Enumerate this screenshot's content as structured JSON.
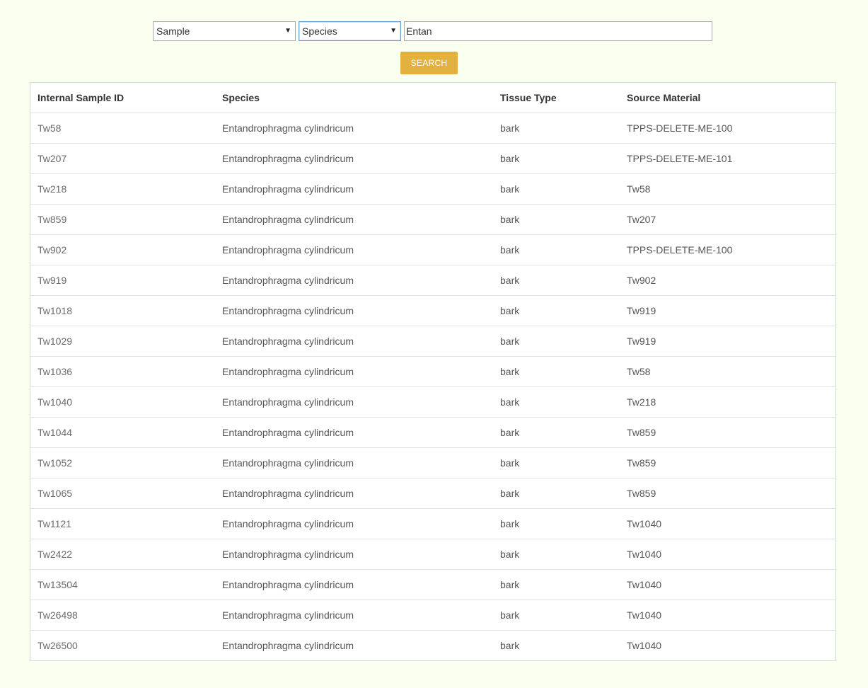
{
  "search": {
    "field_select": "Sample",
    "field_select_arrow": "▼",
    "filter_select": "Species",
    "filter_select_arrow": "▼",
    "query_value": "Entan",
    "button_label": "SEARCH"
  },
  "table": {
    "headers": [
      "Internal Sample ID",
      "Species",
      "Tissue Type",
      "Source Material"
    ],
    "rows": [
      [
        "Tw58",
        "Entandrophragma cylindricum",
        "bark",
        "TPPS-DELETE-ME-100"
      ],
      [
        "Tw207",
        "Entandrophragma cylindricum",
        "bark",
        "TPPS-DELETE-ME-101"
      ],
      [
        "Tw218",
        "Entandrophragma cylindricum",
        "bark",
        "Tw58"
      ],
      [
        "Tw859",
        "Entandrophragma cylindricum",
        "bark",
        "Tw207"
      ],
      [
        "Tw902",
        "Entandrophragma cylindricum",
        "bark",
        "TPPS-DELETE-ME-100"
      ],
      [
        "Tw919",
        "Entandrophragma cylindricum",
        "bark",
        "Tw902"
      ],
      [
        "Tw1018",
        "Entandrophragma cylindricum",
        "bark",
        "Tw919"
      ],
      [
        "Tw1029",
        "Entandrophragma cylindricum",
        "bark",
        "Tw919"
      ],
      [
        "Tw1036",
        "Entandrophragma cylindricum",
        "bark",
        "Tw58"
      ],
      [
        "Tw1040",
        "Entandrophragma cylindricum",
        "bark",
        "Tw218"
      ],
      [
        "Tw1044",
        "Entandrophragma cylindricum",
        "bark",
        "Tw859"
      ],
      [
        "Tw1052",
        "Entandrophragma cylindricum",
        "bark",
        "Tw859"
      ],
      [
        "Tw1065",
        "Entandrophragma cylindricum",
        "bark",
        "Tw859"
      ],
      [
        "Tw1121",
        "Entandrophragma cylindricum",
        "bark",
        "Tw1040"
      ],
      [
        "Tw2422",
        "Entandrophragma cylindricum",
        "bark",
        "Tw1040"
      ],
      [
        "Tw13504",
        "Entandrophragma cylindricum",
        "bark",
        "Tw1040"
      ],
      [
        "Tw26498",
        "Entandrophragma cylindricum",
        "bark",
        "Tw1040"
      ],
      [
        "Tw26500",
        "Entandrophragma cylindricum",
        "bark",
        "Tw1040"
      ]
    ]
  },
  "colors": {
    "page_background": "#fbfff0",
    "button_background": "#e3b23e",
    "table_border": "#c6e3cf"
  }
}
